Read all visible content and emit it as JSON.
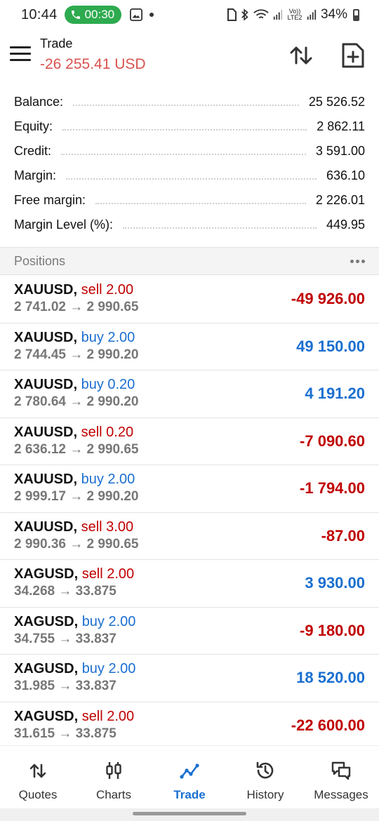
{
  "status_bar": {
    "time": "10:44",
    "call_timer": "00:30",
    "battery": "34%",
    "network_label": "Vo)) LTE2"
  },
  "header": {
    "title": "Trade",
    "profit": "-26 255.41 USD"
  },
  "summary": [
    {
      "label": "Balance:",
      "value": "25 526.52"
    },
    {
      "label": "Equity:",
      "value": "2 862.11"
    },
    {
      "label": "Credit:",
      "value": "3 591.00"
    },
    {
      "label": "Margin:",
      "value": "636.10"
    },
    {
      "label": "Free margin:",
      "value": "2 226.01"
    },
    {
      "label": "Margin Level (%):",
      "value": "449.95"
    }
  ],
  "positions_header": "Positions",
  "positions": [
    {
      "symbol": "XAUUSD,",
      "side": "sell 2.00",
      "side_type": "sell",
      "prices": "2 741.02 → 2 990.65",
      "profit": "-49 926.00",
      "profit_sign": "neg"
    },
    {
      "symbol": "XAUUSD,",
      "side": "buy 2.00",
      "side_type": "buy",
      "prices": "2 744.45 → 2 990.20",
      "profit": "49 150.00",
      "profit_sign": "pos"
    },
    {
      "symbol": "XAUUSD,",
      "side": "buy 0.20",
      "side_type": "buy",
      "prices": "2 780.64 → 2 990.20",
      "profit": "4 191.20",
      "profit_sign": "pos"
    },
    {
      "symbol": "XAUUSD,",
      "side": "sell 0.20",
      "side_type": "sell",
      "prices": "2 636.12 → 2 990.65",
      "profit": "-7 090.60",
      "profit_sign": "neg"
    },
    {
      "symbol": "XAUUSD,",
      "side": "buy 2.00",
      "side_type": "buy",
      "prices": "2 999.17 → 2 990.20",
      "profit": "-1 794.00",
      "profit_sign": "neg"
    },
    {
      "symbol": "XAUUSD,",
      "side": "sell 3.00",
      "side_type": "sell",
      "prices": "2 990.36 → 2 990.65",
      "profit": "-87.00",
      "profit_sign": "neg"
    },
    {
      "symbol": "XAGUSD,",
      "side": "sell 2.00",
      "side_type": "sell",
      "prices": "34.268 → 33.875",
      "profit": "3 930.00",
      "profit_sign": "pos"
    },
    {
      "symbol": "XAGUSD,",
      "side": "buy 2.00",
      "side_type": "buy",
      "prices": "34.755 → 33.837",
      "profit": "-9 180.00",
      "profit_sign": "neg"
    },
    {
      "symbol": "XAGUSD,",
      "side": "buy 2.00",
      "side_type": "buy",
      "prices": "31.985 → 33.837",
      "profit": "18 520.00",
      "profit_sign": "pos"
    },
    {
      "symbol": "XAGUSD,",
      "side": "sell 2.00",
      "side_type": "sell",
      "prices": "31.615 → 33.875",
      "profit": "-22 600.00",
      "profit_sign": "neg"
    }
  ],
  "nav": [
    {
      "label": "Quotes",
      "icon": "quotes-icon",
      "active": false
    },
    {
      "label": "Charts",
      "icon": "charts-icon",
      "active": false
    },
    {
      "label": "Trade",
      "icon": "trade-icon",
      "active": true
    },
    {
      "label": "History",
      "icon": "history-icon",
      "active": false
    },
    {
      "label": "Messages",
      "icon": "messages-icon",
      "active": false
    }
  ],
  "colors": {
    "sell": "#c00000",
    "buy": "#1a6fd0",
    "header_profit": "#d9534f",
    "active_nav": "#1a6fd0",
    "call_pill": "#2eaa4f"
  }
}
